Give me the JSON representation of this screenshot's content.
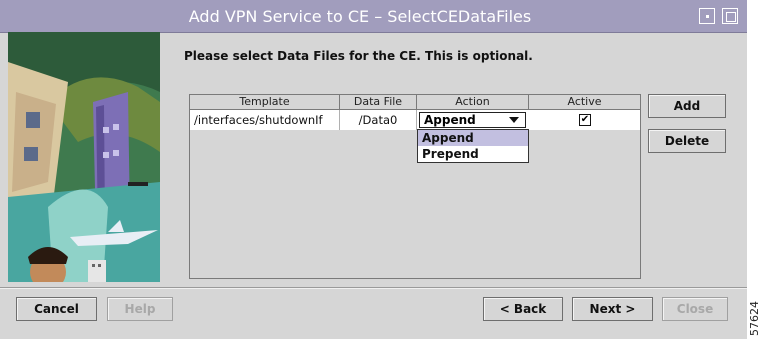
{
  "window": {
    "title": "Add VPN Service to CE – SelectCEDataFiles"
  },
  "prompt": "Please select Data Files for the CE. This is optional.",
  "table": {
    "columns": [
      "Template",
      "Data File",
      "Action",
      "Active"
    ],
    "rows": [
      {
        "template": "/interfaces/shutdownIf",
        "data_file": "/Data0",
        "action": "Append",
        "active": true
      }
    ]
  },
  "dropdown": {
    "options": [
      "Append",
      "Prepend"
    ],
    "selected": "Append"
  },
  "side_buttons": {
    "add": "Add",
    "delete": "Delete"
  },
  "footer": {
    "cancel": "Cancel",
    "help": "Help",
    "back": "< Back",
    "next": "Next >",
    "close": "Close"
  },
  "checkbox_glyph": "✔",
  "figure_number": "57624",
  "colors": {
    "titlebar": "#a19dbd",
    "selected_option": "#c2bfe0",
    "background": "#d6d6d6"
  }
}
